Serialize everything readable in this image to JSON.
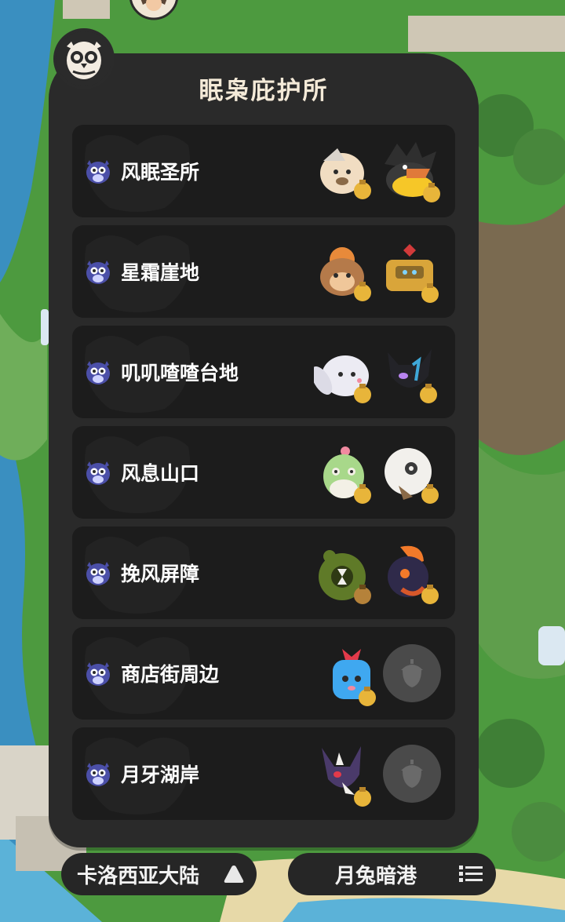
{
  "panel": {
    "title": "眠枭庇护所"
  },
  "locations": [
    {
      "name": "风眠圣所",
      "pets": [
        "hamster-pet",
        "crow-duck-pet"
      ]
    },
    {
      "name": "星霜崖地",
      "pets": [
        "monkey-pet",
        "gold-robot-pet"
      ]
    },
    {
      "name": "叽叽喳喳台地",
      "pets": [
        "bunny-pet",
        "black-cat-pet"
      ]
    },
    {
      "name": "风息山口",
      "pets": [
        "sprout-bird-pet",
        "skull-pet"
      ]
    },
    {
      "name": "挽风屏障",
      "pets": [
        "hourglass-pet",
        "fire-bird-pet"
      ]
    },
    {
      "name": "商店街周边",
      "pets": [
        "gift-box-pet"
      ],
      "empty_slot": "acorn-icon"
    },
    {
      "name": "月牙湖岸",
      "pets": [
        "purple-fox-pet"
      ],
      "empty_slot": "acorn-icon"
    }
  ],
  "footer": {
    "region_label": "卡洛西亚大陆",
    "region_icon": "triangle-up-icon",
    "area_label": "月兔暗港",
    "area_icon": "list-icon"
  },
  "colors": {
    "panel_bg": "#2a2a2a",
    "row_bg": "#1c1c1c",
    "title_color": "#f4ead8",
    "bell_gold": "#e8b53a",
    "owl_icon_purple": "#4b4fa8"
  }
}
